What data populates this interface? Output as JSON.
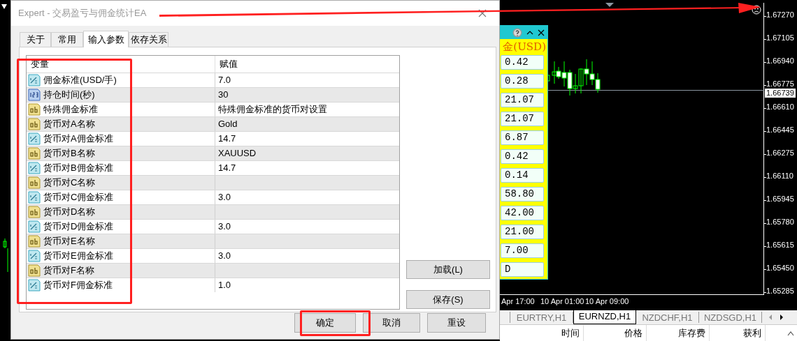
{
  "dialog": {
    "title": "Expert - 交易盈亏与佣金统计EA",
    "tabs": [
      {
        "label": "关于",
        "selected": false
      },
      {
        "label": "常用",
        "selected": false
      },
      {
        "label": "输入参数",
        "selected": true
      },
      {
        "label": "依存关系",
        "selected": false
      }
    ],
    "table": {
      "columns": [
        "变量",
        "赋值"
      ],
      "rows": [
        {
          "kind": "double",
          "name": "佣金标准(USD/手)",
          "value": "7.0"
        },
        {
          "kind": "int",
          "name": "持仓时间(秒)",
          "value": "30"
        },
        {
          "kind": "string",
          "name": "特殊佣金标准",
          "value": "特殊佣金标准的货币对设置"
        },
        {
          "kind": "string",
          "name": "货币对A名称",
          "value": "Gold"
        },
        {
          "kind": "double",
          "name": "货币对A佣金标准",
          "value": "14.7"
        },
        {
          "kind": "string",
          "name": "货币对B名称",
          "value": "XAUUSD"
        },
        {
          "kind": "double",
          "name": "货币对B佣金标准",
          "value": "14.7"
        },
        {
          "kind": "string",
          "name": "货币对C名称"
        },
        {
          "kind": "double",
          "name": "货币对C佣金标准",
          "value": "3.0"
        },
        {
          "kind": "string",
          "name": "货币对D名称"
        },
        {
          "kind": "double",
          "name": "货币对D佣金标准",
          "value": "3.0"
        },
        {
          "kind": "string",
          "name": "货币对E名称"
        },
        {
          "kind": "double",
          "name": "货币对E佣金标准",
          "value": "3.0"
        },
        {
          "kind": "string",
          "name": "货币对F名称"
        },
        {
          "kind": "double",
          "name": "货币对F佣金标准",
          "value": "1.0"
        }
      ]
    },
    "side_buttons": [
      "加载(L)",
      "保存(S)"
    ],
    "buttons": [
      "确定",
      "取消",
      "重设"
    ]
  },
  "chart": {
    "panel": {
      "title": "金(USD)",
      "values": [
        "0.42",
        "0.28",
        "21.07",
        "21.07",
        "6.87",
        "0.42",
        "0.14",
        "58.80",
        "42.00",
        "21.00",
        "7.00",
        "D"
      ]
    },
    "price_labels": [
      "1.67270",
      "1.67105",
      "1.66940",
      "1.66775",
      "1.66610",
      "1.66445",
      "1.66275",
      "1.66110",
      "1.65945",
      "1.65780",
      "1.65615",
      "1.65450",
      "1.65285"
    ],
    "current_price": "1.66739",
    "time_labels": [
      "Apr 17:00",
      "10 Apr 01:00",
      "10 Apr 09:00"
    ]
  },
  "chart_tabs": [
    {
      "label": "EURTRY,H1",
      "selected": false
    },
    {
      "label": "EURNZD,H1",
      "selected": true
    },
    {
      "label": "NZDCHF,H1",
      "selected": false
    },
    {
      "label": "NZDSGD,H1",
      "selected": false
    }
  ],
  "terminal_columns": [
    "时间",
    "价格",
    "库存费",
    "获利"
  ]
}
